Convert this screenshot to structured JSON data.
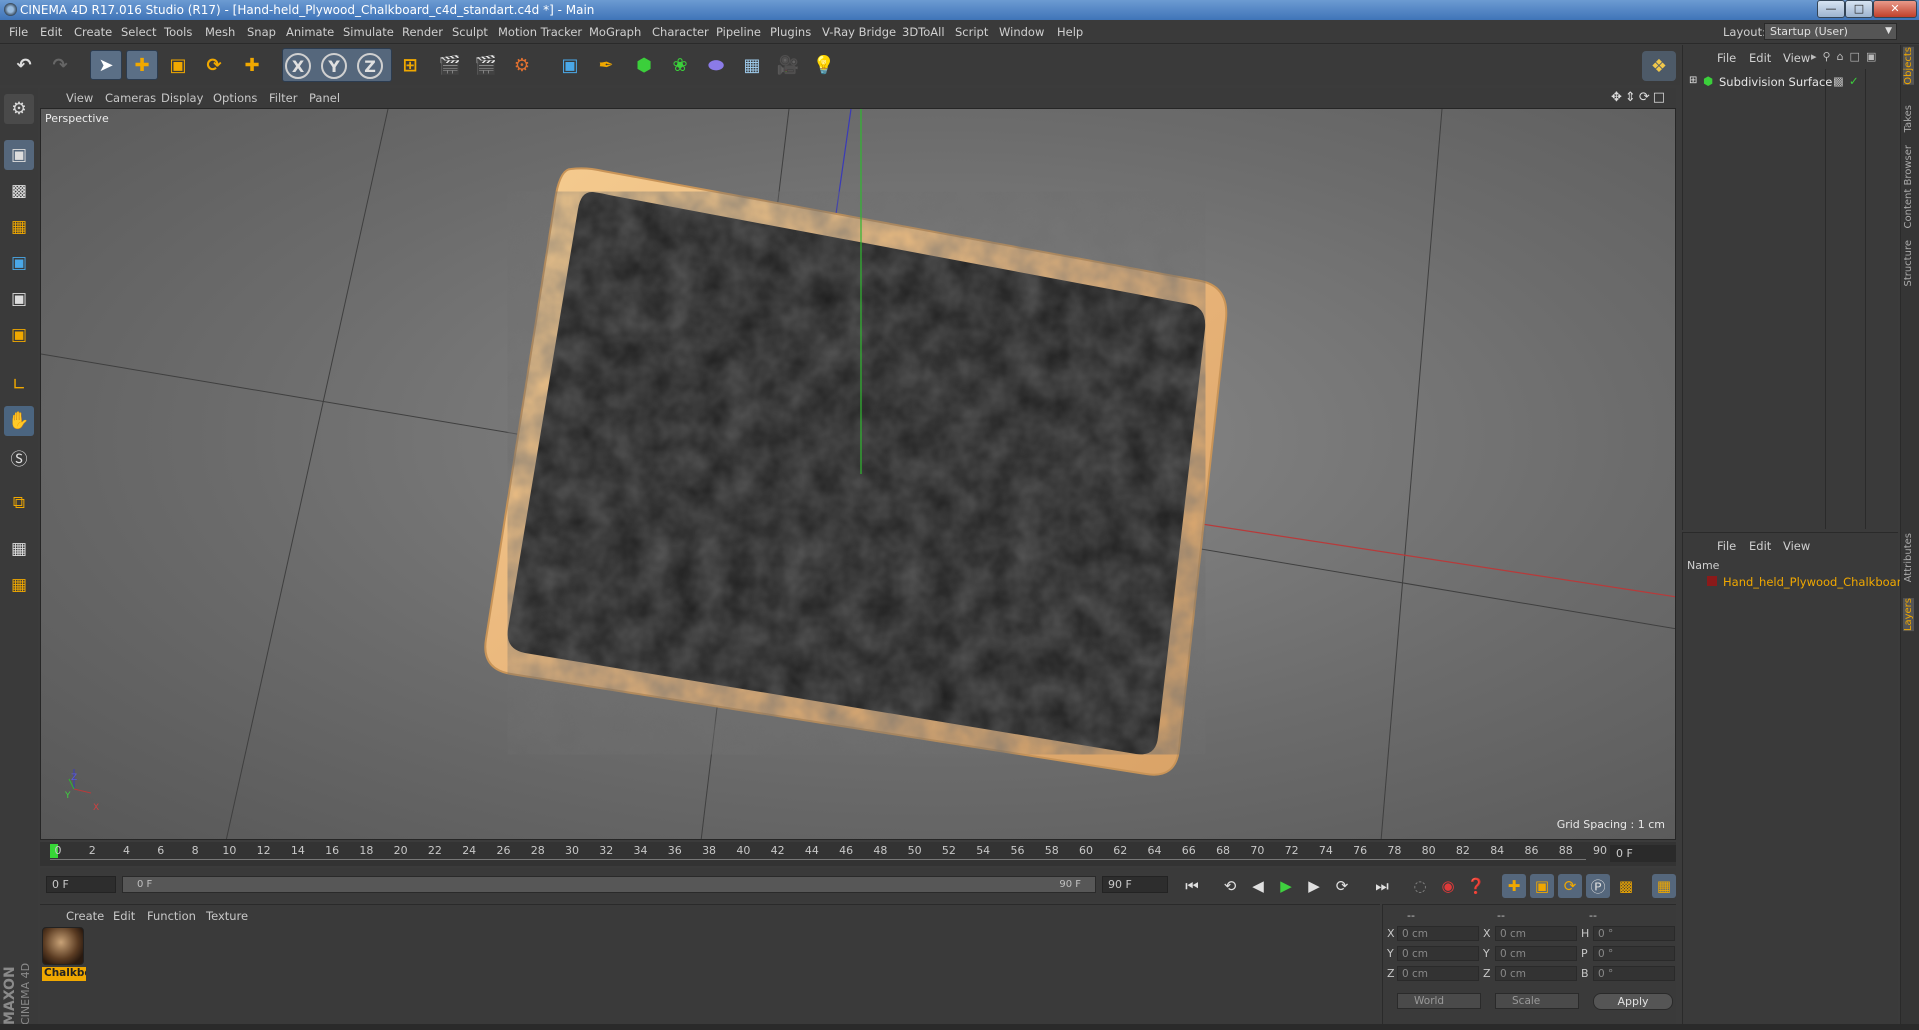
{
  "window": {
    "title": "CINEMA 4D R17.016 Studio (R17) - [Hand-held_Plywood_Chalkboard_c4d_standart.c4d *] - Main",
    "controls": [
      "minimize",
      "maximize",
      "close"
    ]
  },
  "menubar": {
    "items": [
      "File",
      "Edit",
      "Create",
      "Select",
      "Tools",
      "Mesh",
      "Snap",
      "Animate",
      "Simulate",
      "Render",
      "Sculpt",
      "Motion Tracker",
      "MoGraph",
      "Character",
      "Pipeline",
      "Plugins",
      "V-Ray Bridge",
      "3DToAll",
      "Script",
      "Window",
      "Help"
    ],
    "layout_label": "Layout:",
    "layout_value": "Startup (User)"
  },
  "toolbar": {
    "axis_x": "X",
    "axis_y": "Y",
    "axis_z": "Z"
  },
  "viewport": {
    "menu": [
      "View",
      "Cameras",
      "Display",
      "Options",
      "Filter",
      "Panel"
    ],
    "camera_label": "Perspective",
    "grid_spacing": "Grid Spacing : 1 cm",
    "axis_gizmo": {
      "z": "Z",
      "y": "Y",
      "x": "X"
    }
  },
  "timeline": {
    "ticks": [
      "0",
      "2",
      "4",
      "6",
      "8",
      "10",
      "12",
      "14",
      "16",
      "18",
      "20",
      "22",
      "24",
      "26",
      "28",
      "30",
      "32",
      "34",
      "36",
      "38",
      "40",
      "42",
      "44",
      "46",
      "48",
      "50",
      "52",
      "54",
      "56",
      "58",
      "60",
      "62",
      "64",
      "66",
      "68",
      "70",
      "72",
      "74",
      "76",
      "78",
      "80",
      "82",
      "84",
      "86",
      "88",
      "90"
    ],
    "current_frame": "0 F",
    "start_field": "0 F",
    "slider_start": "0 F",
    "slider_end": "90 F",
    "end_field": "90 F"
  },
  "material_manager": {
    "menu": [
      "Create",
      "Edit",
      "Function",
      "Texture"
    ],
    "materials": [
      {
        "name": "Chalkbc"
      }
    ]
  },
  "coordinates": {
    "header": [
      "--",
      "--",
      "--"
    ],
    "rows": [
      {
        "axis": "X",
        "pos": "0 cm",
        "size_axis": "X",
        "size": "0 cm",
        "rot_axis": "H",
        "rot": "0 °"
      },
      {
        "axis": "Y",
        "pos": "0 cm",
        "size_axis": "Y",
        "size": "0 cm",
        "rot_axis": "P",
        "rot": "0 °"
      },
      {
        "axis": "Z",
        "pos": "0 cm",
        "size_axis": "Z",
        "size": "0 cm",
        "rot_axis": "B",
        "rot": "0 °"
      }
    ],
    "mode_world": "World",
    "mode_scale": "Scale",
    "apply_label": "Apply"
  },
  "object_manager": {
    "menu": [
      "File",
      "Edit",
      "View"
    ],
    "objects": [
      {
        "name": "Subdivision Surface"
      }
    ]
  },
  "layer_manager": {
    "menu": [
      "File",
      "Edit",
      "View"
    ],
    "column_name": "Name",
    "layers": [
      {
        "name": "Hand_held_Plywood_Chalkboard",
        "color": "#8b1a1a"
      }
    ]
  },
  "side_tabs": [
    "Objects",
    "Takes",
    "Content Browser",
    "Structure",
    "Attributes",
    "Layers"
  ],
  "branding": {
    "line1": "MAXON",
    "line2": "CINEMA 4D"
  },
  "colors": {
    "accent": "#f0a800",
    "selection": "#5b6f86",
    "x_axis": "#c03030",
    "y_axis": "#30a030",
    "z_axis": "#3040c0"
  }
}
